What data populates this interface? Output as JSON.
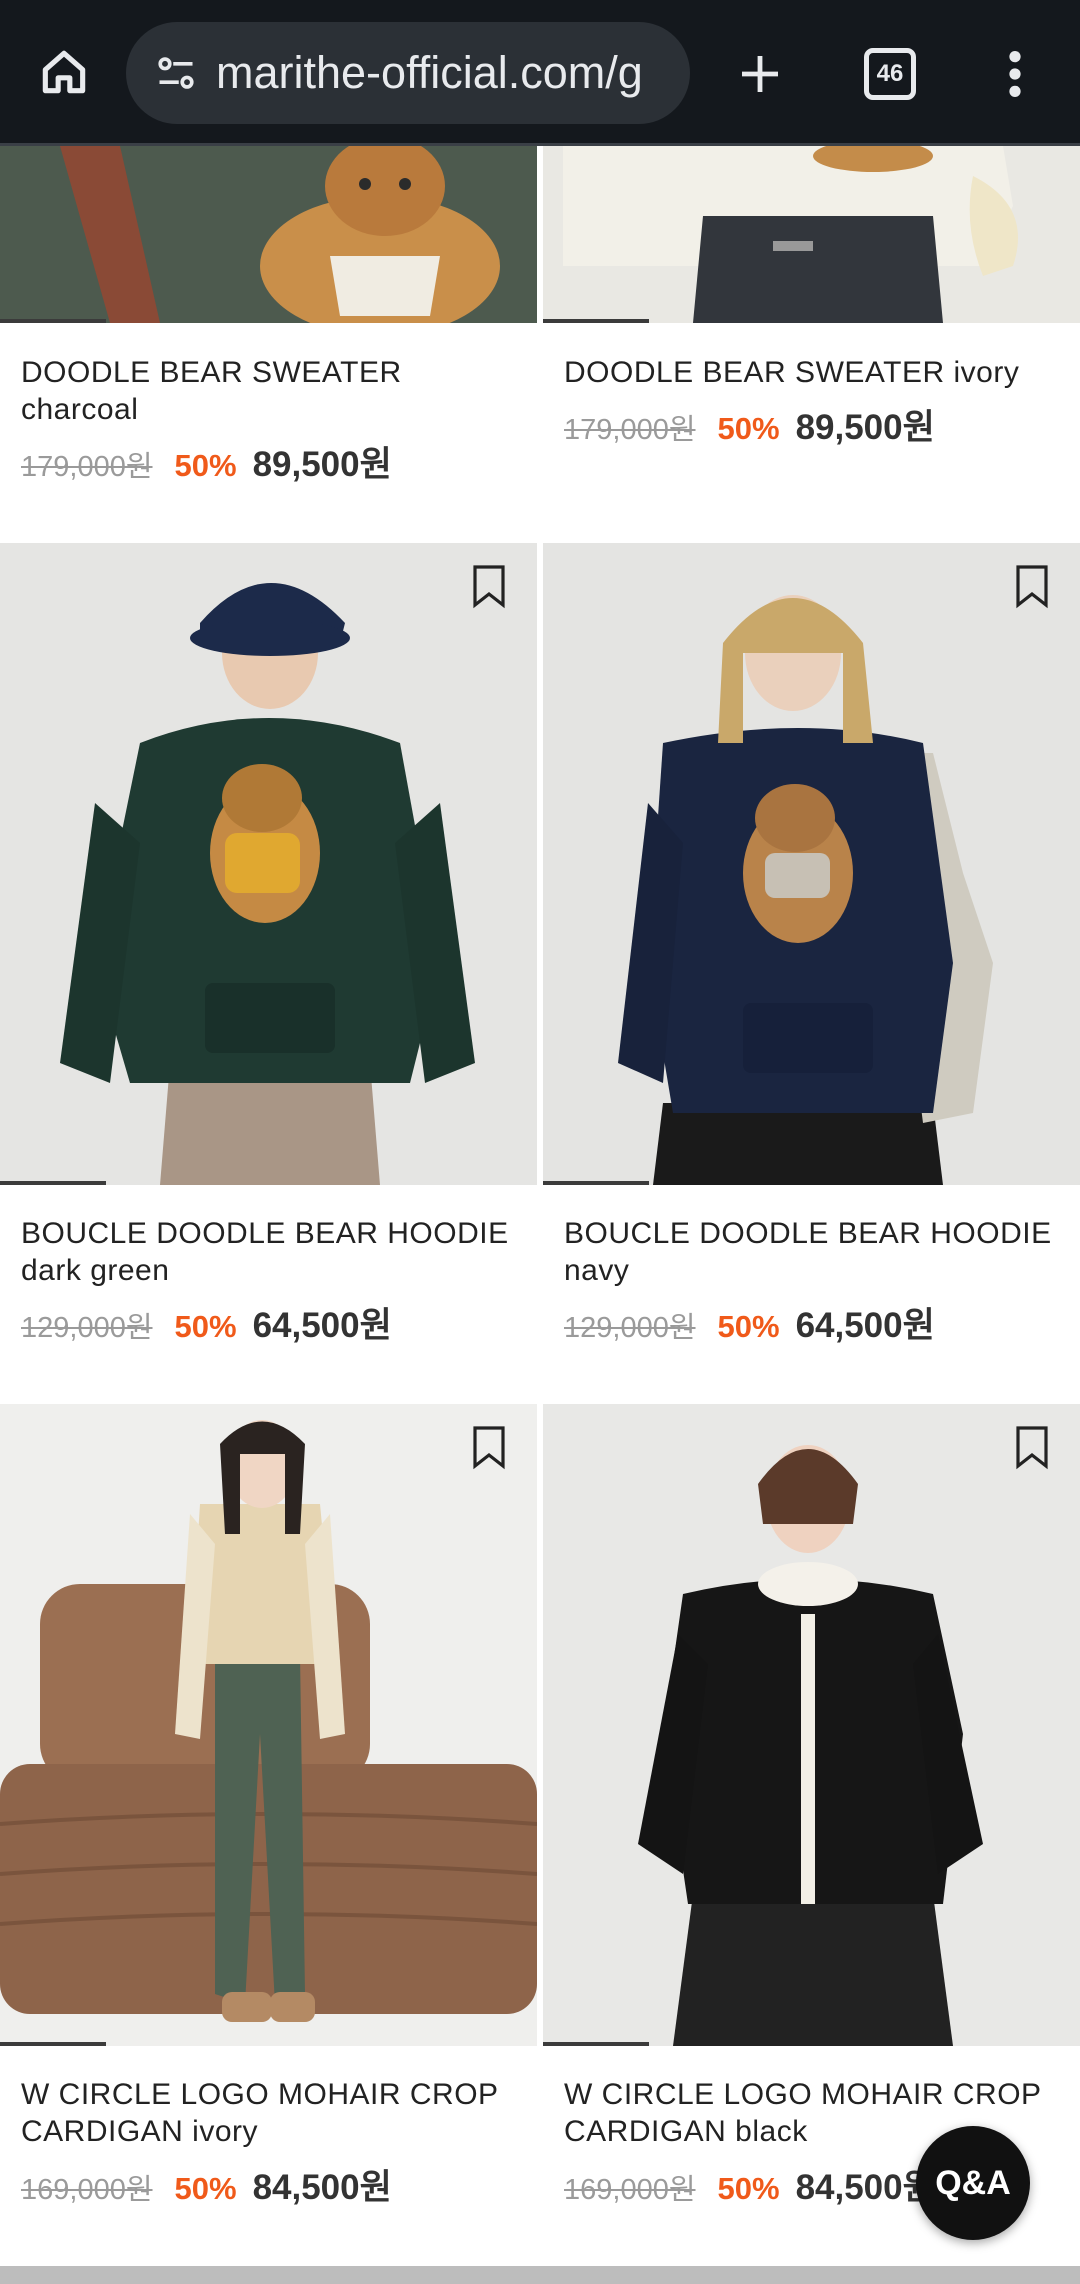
{
  "browser": {
    "url": "marithe-official.com/g",
    "tab_count": "46"
  },
  "products": [
    {
      "name": "DOODLE BEAR SWEATER charcoal",
      "original_price": "179,000원",
      "discount": "50%",
      "sale_price": "89,500원"
    },
    {
      "name": "DOODLE BEAR SWEATER ivory",
      "original_price": "179,000원",
      "discount": "50%",
      "sale_price": "89,500원"
    },
    {
      "name": "BOUCLE DOODLE BEAR HOODIE dark green",
      "original_price": "129,000원",
      "discount": "50%",
      "sale_price": "64,500원"
    },
    {
      "name": "BOUCLE DOODLE BEAR HOODIE navy",
      "original_price": "129,000원",
      "discount": "50%",
      "sale_price": "64,500원"
    },
    {
      "name": "W CIRCLE LOGO MOHAIR CROP CARDIGAN ivory",
      "original_price": "169,000원",
      "discount": "50%",
      "sale_price": "84,500원"
    },
    {
      "name": "W CIRCLE LOGO MOHAIR CROP CARDIGAN black",
      "original_price": "169,000원",
      "discount": "50%",
      "sale_price": "84,500원"
    }
  ],
  "qa_button": "Q&A",
  "colors": {
    "discount": "#f05a1a",
    "toolbar_bg": "#14181d"
  }
}
